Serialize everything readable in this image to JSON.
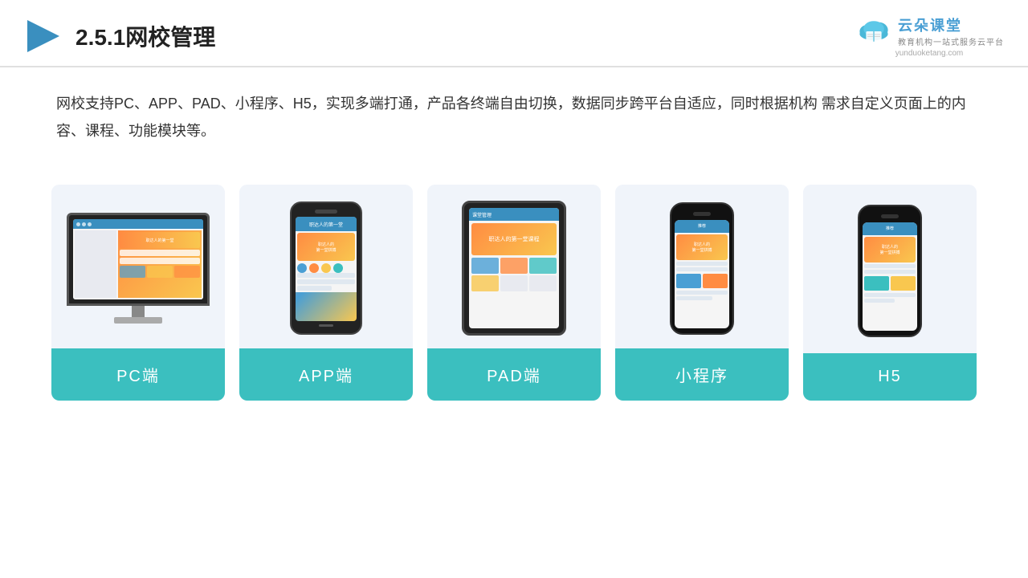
{
  "header": {
    "title": "2.5.1网校管理",
    "logo": {
      "name": "云朵课堂",
      "url": "yunduoketang.com",
      "tagline": "教育机构一站\n式服务云平台"
    }
  },
  "description": "网校支持PC、APP、PAD、小程序、H5，实现多端打通，产品各终端自由切换，数据同步跨平台自适应，同时根据机构\n需求自定义页面上的内容、课程、功能模块等。",
  "cards": [
    {
      "id": "pc",
      "label": "PC端"
    },
    {
      "id": "app",
      "label": "APP端"
    },
    {
      "id": "pad",
      "label": "PAD端"
    },
    {
      "id": "miniprogram",
      "label": "小程序"
    },
    {
      "id": "h5",
      "label": "H5"
    }
  ],
  "colors": {
    "accent": "#3bbfbf",
    "card_bg": "#f0f4fa",
    "title": "#222222",
    "text": "#333333"
  }
}
